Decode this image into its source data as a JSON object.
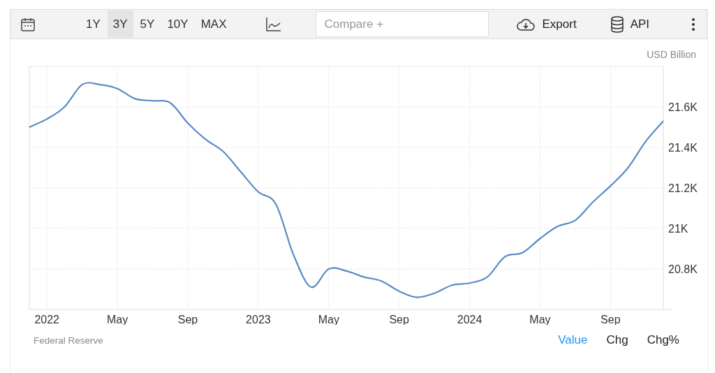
{
  "toolbar": {
    "ranges": [
      {
        "label": "1Y",
        "selected": false
      },
      {
        "label": "3Y",
        "selected": true
      },
      {
        "label": "5Y",
        "selected": false
      },
      {
        "label": "10Y",
        "selected": false
      },
      {
        "label": "MAX",
        "selected": false
      }
    ],
    "compare": {
      "placeholder": "Compare +"
    },
    "export": {
      "label": "Export"
    },
    "api": {
      "label": "API"
    }
  },
  "chart": {
    "unit": "USD Billion",
    "chart_data": {
      "type": "line",
      "grid": true,
      "categories": [
        null,
        "2022",
        null,
        null,
        null,
        "May",
        null,
        null,
        null,
        "Sep",
        null,
        null,
        null,
        "2023",
        null,
        null,
        null,
        "May",
        null,
        null,
        null,
        "Sep",
        null,
        null,
        null,
        "2024",
        null,
        null,
        null,
        "May",
        null,
        null,
        null,
        "Sep",
        null,
        null,
        null
      ],
      "series": [
        {
          "color": "#5b8ac6",
          "values": [
            21500,
            21540,
            21600,
            21710,
            21710,
            21690,
            21640,
            21630,
            21620,
            21520,
            21440,
            21380,
            21280,
            21180,
            21120,
            20870,
            20710,
            20800,
            20790,
            20760,
            20740,
            20690,
            20660,
            20680,
            20720,
            20730,
            20760,
            20860,
            20880,
            20950,
            21010,
            21040,
            21130,
            21210,
            21300,
            21430,
            21530
          ]
        }
      ],
      "ylim": [
        20600,
        21800
      ],
      "yticks": [
        {
          "value": 20800,
          "label": "20.8K"
        },
        {
          "value": 21000,
          "label": "21K"
        },
        {
          "value": 21200,
          "label": "21.2K"
        },
        {
          "value": 21400,
          "label": "21.4K"
        },
        {
          "value": 21600,
          "label": "21.6K"
        }
      ]
    }
  },
  "footer": {
    "source": "Federal Reserve",
    "views": [
      {
        "label": "Value",
        "selected": true
      },
      {
        "label": "Chg",
        "selected": false
      },
      {
        "label": "Chg%",
        "selected": false
      }
    ]
  }
}
